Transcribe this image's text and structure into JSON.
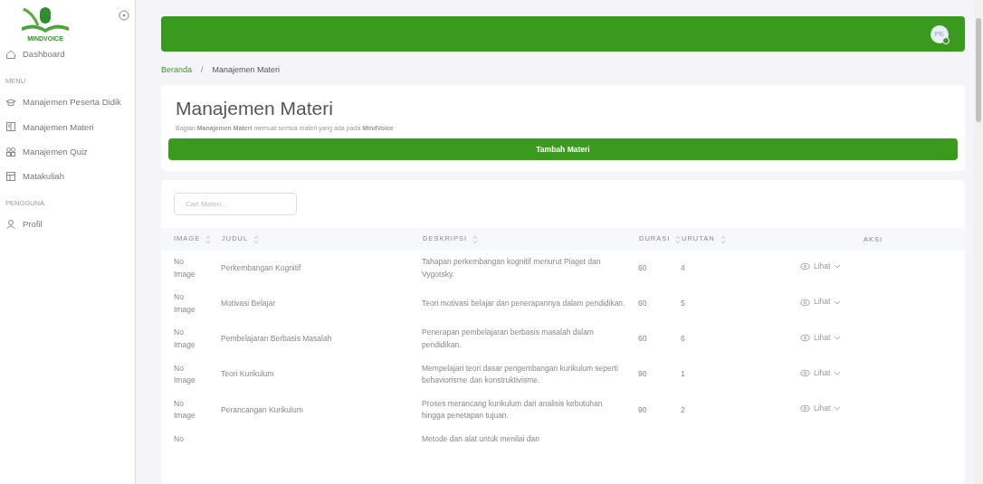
{
  "sidebar": {
    "logo_text": "MINDVOICE",
    "home": {
      "label": "Dashboard",
      "selected": false
    },
    "sections": [
      {
        "title": "MENU",
        "items": [
          {
            "label": "Manajemen Peserta Didik",
            "selected": false
          },
          {
            "label": "Manajemen Materi",
            "selected": false
          },
          {
            "label": "Manajemen Quiz",
            "selected": false
          },
          {
            "label": "Matakuliah",
            "selected": false
          }
        ]
      },
      {
        "title": "PENGGUNA",
        "items": [
          {
            "label": "Profil",
            "selected": false
          }
        ]
      }
    ]
  },
  "topbar": {
    "avatar": "PE",
    "online": true
  },
  "breadcrumb": {
    "separator": "/",
    "items": [
      {
        "label": "Beranda",
        "link": true
      },
      {
        "label": "Manajemen Materi",
        "link": false
      }
    ]
  },
  "header": {
    "title": "Manajemen Materi",
    "subtitle": "Bagian **Manajemen Materi** memuat semua materi yang ada pada **MindVoice**",
    "button": "Tambah Materi"
  },
  "table": {
    "search_placeholder": "Cari Materi...",
    "columns": [
      {
        "label": "IMAGE",
        "sortable": true
      },
      {
        "label": "JUDUL",
        "sortable": true
      },
      {
        "label": "DESKRIPSI",
        "sortable": true
      },
      {
        "label": "DURASI",
        "sortable": true
      },
      {
        "label": "URUTAN",
        "sortable": true
      },
      {
        "label": "AKSI",
        "sortable": false
      }
    ],
    "rows": [
      {
        "image": "No Image",
        "judul": "Perkembangan Kognitif",
        "deskripsi": "Tahapan perkembangan kognitif menurut Piaget dan Vygotsky.",
        "durasi": "60",
        "urutan": "4",
        "aksi": "Lihat"
      },
      {
        "image": "No Image",
        "judul": "Motivasi Belajar",
        "deskripsi": "Teori motivasi belajar dan penerapannya dalam pendidikan.",
        "durasi": "60",
        "urutan": "5",
        "aksi": "Lihat"
      },
      {
        "image": "No Image",
        "judul": "Pembelajaran Berbasis Masalah",
        "deskripsi": "Penerapan pembelajaran berbasis masalah dalam pendidikan.",
        "durasi": "60",
        "urutan": "6",
        "aksi": "Lihat"
      },
      {
        "image": "No Image",
        "judul": "Teori Kurikulum",
        "deskripsi": "Mempelajari teori dasar pengembangan kurikulum seperti behaviorisme dan konstruktivisme.",
        "durasi": "90",
        "urutan": "1",
        "aksi": "Lihat"
      },
      {
        "image": "No Image",
        "judul": "Perancangan Kurikulum",
        "deskripsi": "Proses merancang kurikulum dari analisis kebutuhan hingga penetapan tujuan.",
        "durasi": "90",
        "urutan": "2",
        "aksi": "Lihat"
      },
      {
        "image": "No",
        "deskripsi": "Metode dan alat untuk menilai dan"
      }
    ]
  }
}
